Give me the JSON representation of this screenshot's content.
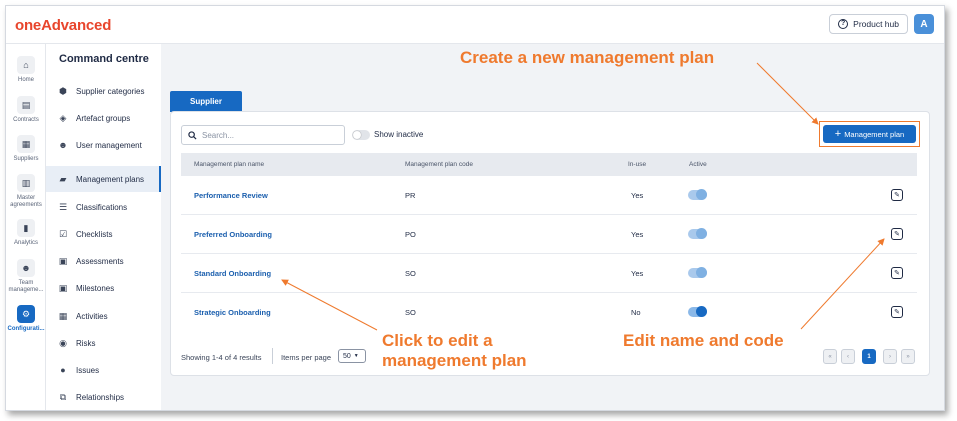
{
  "header": {
    "logo": "oneAdvanced",
    "product_hub_label": "Product hub",
    "avatar_initial": "A"
  },
  "rail": [
    {
      "label": "Home",
      "icon": "home-icon",
      "glyph": "⌂"
    },
    {
      "label": "Contracts",
      "icon": "contracts-icon",
      "glyph": "▤"
    },
    {
      "label": "Suppliers",
      "icon": "suppliers-icon",
      "glyph": "▦"
    },
    {
      "label": "Master agreements",
      "icon": "master-agreements-icon",
      "glyph": "▥"
    },
    {
      "label": "Analytics",
      "icon": "analytics-icon",
      "glyph": "▮"
    },
    {
      "label": "Team manageme...",
      "icon": "team-icon",
      "glyph": "☻"
    },
    {
      "label": "Configurati...",
      "icon": "gear-icon",
      "glyph": "⚙"
    }
  ],
  "nav": {
    "title": "Command centre",
    "items": [
      {
        "label": "Supplier categories",
        "glyph": "⬢"
      },
      {
        "label": "Artefact groups",
        "glyph": "◈"
      },
      {
        "label": "User management",
        "glyph": "☻"
      },
      {
        "label": "Management plans",
        "glyph": "▰"
      },
      {
        "label": "Classifications",
        "glyph": "☰"
      },
      {
        "label": "Checklists",
        "glyph": "☑"
      },
      {
        "label": "Assessments",
        "glyph": "▣"
      },
      {
        "label": "Milestones",
        "glyph": "▣"
      },
      {
        "label": "Activities",
        "glyph": "▦"
      },
      {
        "label": "Risks",
        "glyph": "◉"
      },
      {
        "label": "Issues",
        "glyph": "●"
      },
      {
        "label": "Relationships",
        "glyph": "⧉"
      }
    ]
  },
  "tabs": {
    "supplier": "Supplier"
  },
  "toolbar": {
    "search_placeholder": "Search...",
    "show_inactive": "Show inactive",
    "add_plan": "Management plan",
    "add_glyph": "+"
  },
  "table": {
    "headers": [
      "Management plan name",
      "Management plan code",
      "In-use",
      "Active"
    ],
    "rows": [
      {
        "name": "Performance Review",
        "code": "PR",
        "in_use": "Yes",
        "active": false
      },
      {
        "name": "Preferred Onboarding",
        "code": "PO",
        "in_use": "Yes",
        "active": false
      },
      {
        "name": "Standard Onboarding",
        "code": "SO",
        "in_use": "Yes",
        "active": false
      },
      {
        "name": "Strategic Onboarding",
        "code": "SO",
        "in_use": "No",
        "active": true
      }
    ]
  },
  "footer": {
    "showing": "Showing 1-4 of 4 results",
    "items_per_page_label": "Items per page",
    "items_per_page_value": "50",
    "pager_first": "«",
    "pager_prev": "‹",
    "current_page": "1",
    "pager_next": "›",
    "pager_last": "»"
  },
  "annotations": {
    "create": "Create a new management plan",
    "edit_plan_line1": "Click to edit a",
    "edit_plan_line2": "management plan",
    "edit_name": "Edit name and code",
    "color": "#ef7a2e"
  },
  "colors": {
    "primary": "#1769c2",
    "brand": "#e8452c",
    "accent_annotation": "#ef7a2e"
  }
}
